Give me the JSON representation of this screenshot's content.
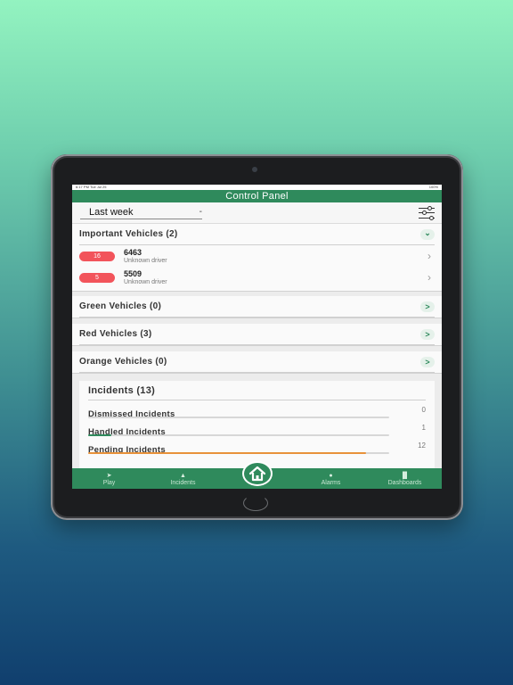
{
  "status_bar": {
    "time": "6:17 PM",
    "date": "Tue Jul 25",
    "battery": "100%"
  },
  "header": {
    "title": "Control Panel"
  },
  "filter": {
    "period": "Last week",
    "caret": "-"
  },
  "groups": [
    {
      "title": "Important Vehicles (2)",
      "toggle": "⌄",
      "vehicles": [
        {
          "badge": "16",
          "id": "6463",
          "driver": "Unknown driver"
        },
        {
          "badge": "5",
          "id": "5509",
          "driver": "Unknown driver"
        }
      ]
    },
    {
      "title": "Green Vehicles (0)",
      "toggle": ">"
    },
    {
      "title": "Red Vehicles (3)",
      "toggle": ">"
    },
    {
      "title": "Orange Vehicles (0)",
      "toggle": ">"
    }
  ],
  "incidents": {
    "title": "Incidents (13)",
    "rows": [
      {
        "label": "Dismissed Incidents",
        "count": "0",
        "progress": 0,
        "color": "#2f8a5c"
      },
      {
        "label": "Handled Incidents",
        "count": "1",
        "progress": 0.077,
        "color": "#2f8a5c"
      },
      {
        "label": "Pending Incidents",
        "count": "12",
        "progress": 0.923,
        "color": "#e8923a"
      }
    ]
  },
  "tabbar": {
    "play": {
      "label": "Play",
      "icon": "play-icon"
    },
    "incidents": {
      "label": "Incidents",
      "icon": "warning-icon"
    },
    "home": {
      "label": "",
      "icon": "home-icon"
    },
    "alarms": {
      "label": "Alarms",
      "icon": "bell-icon"
    },
    "dashboards": {
      "label": "Dashboards",
      "icon": "bar-chart-icon"
    }
  },
  "colors": {
    "brand": "#2f8a5c",
    "badge": "#f2545b",
    "pending": "#e8923a"
  }
}
